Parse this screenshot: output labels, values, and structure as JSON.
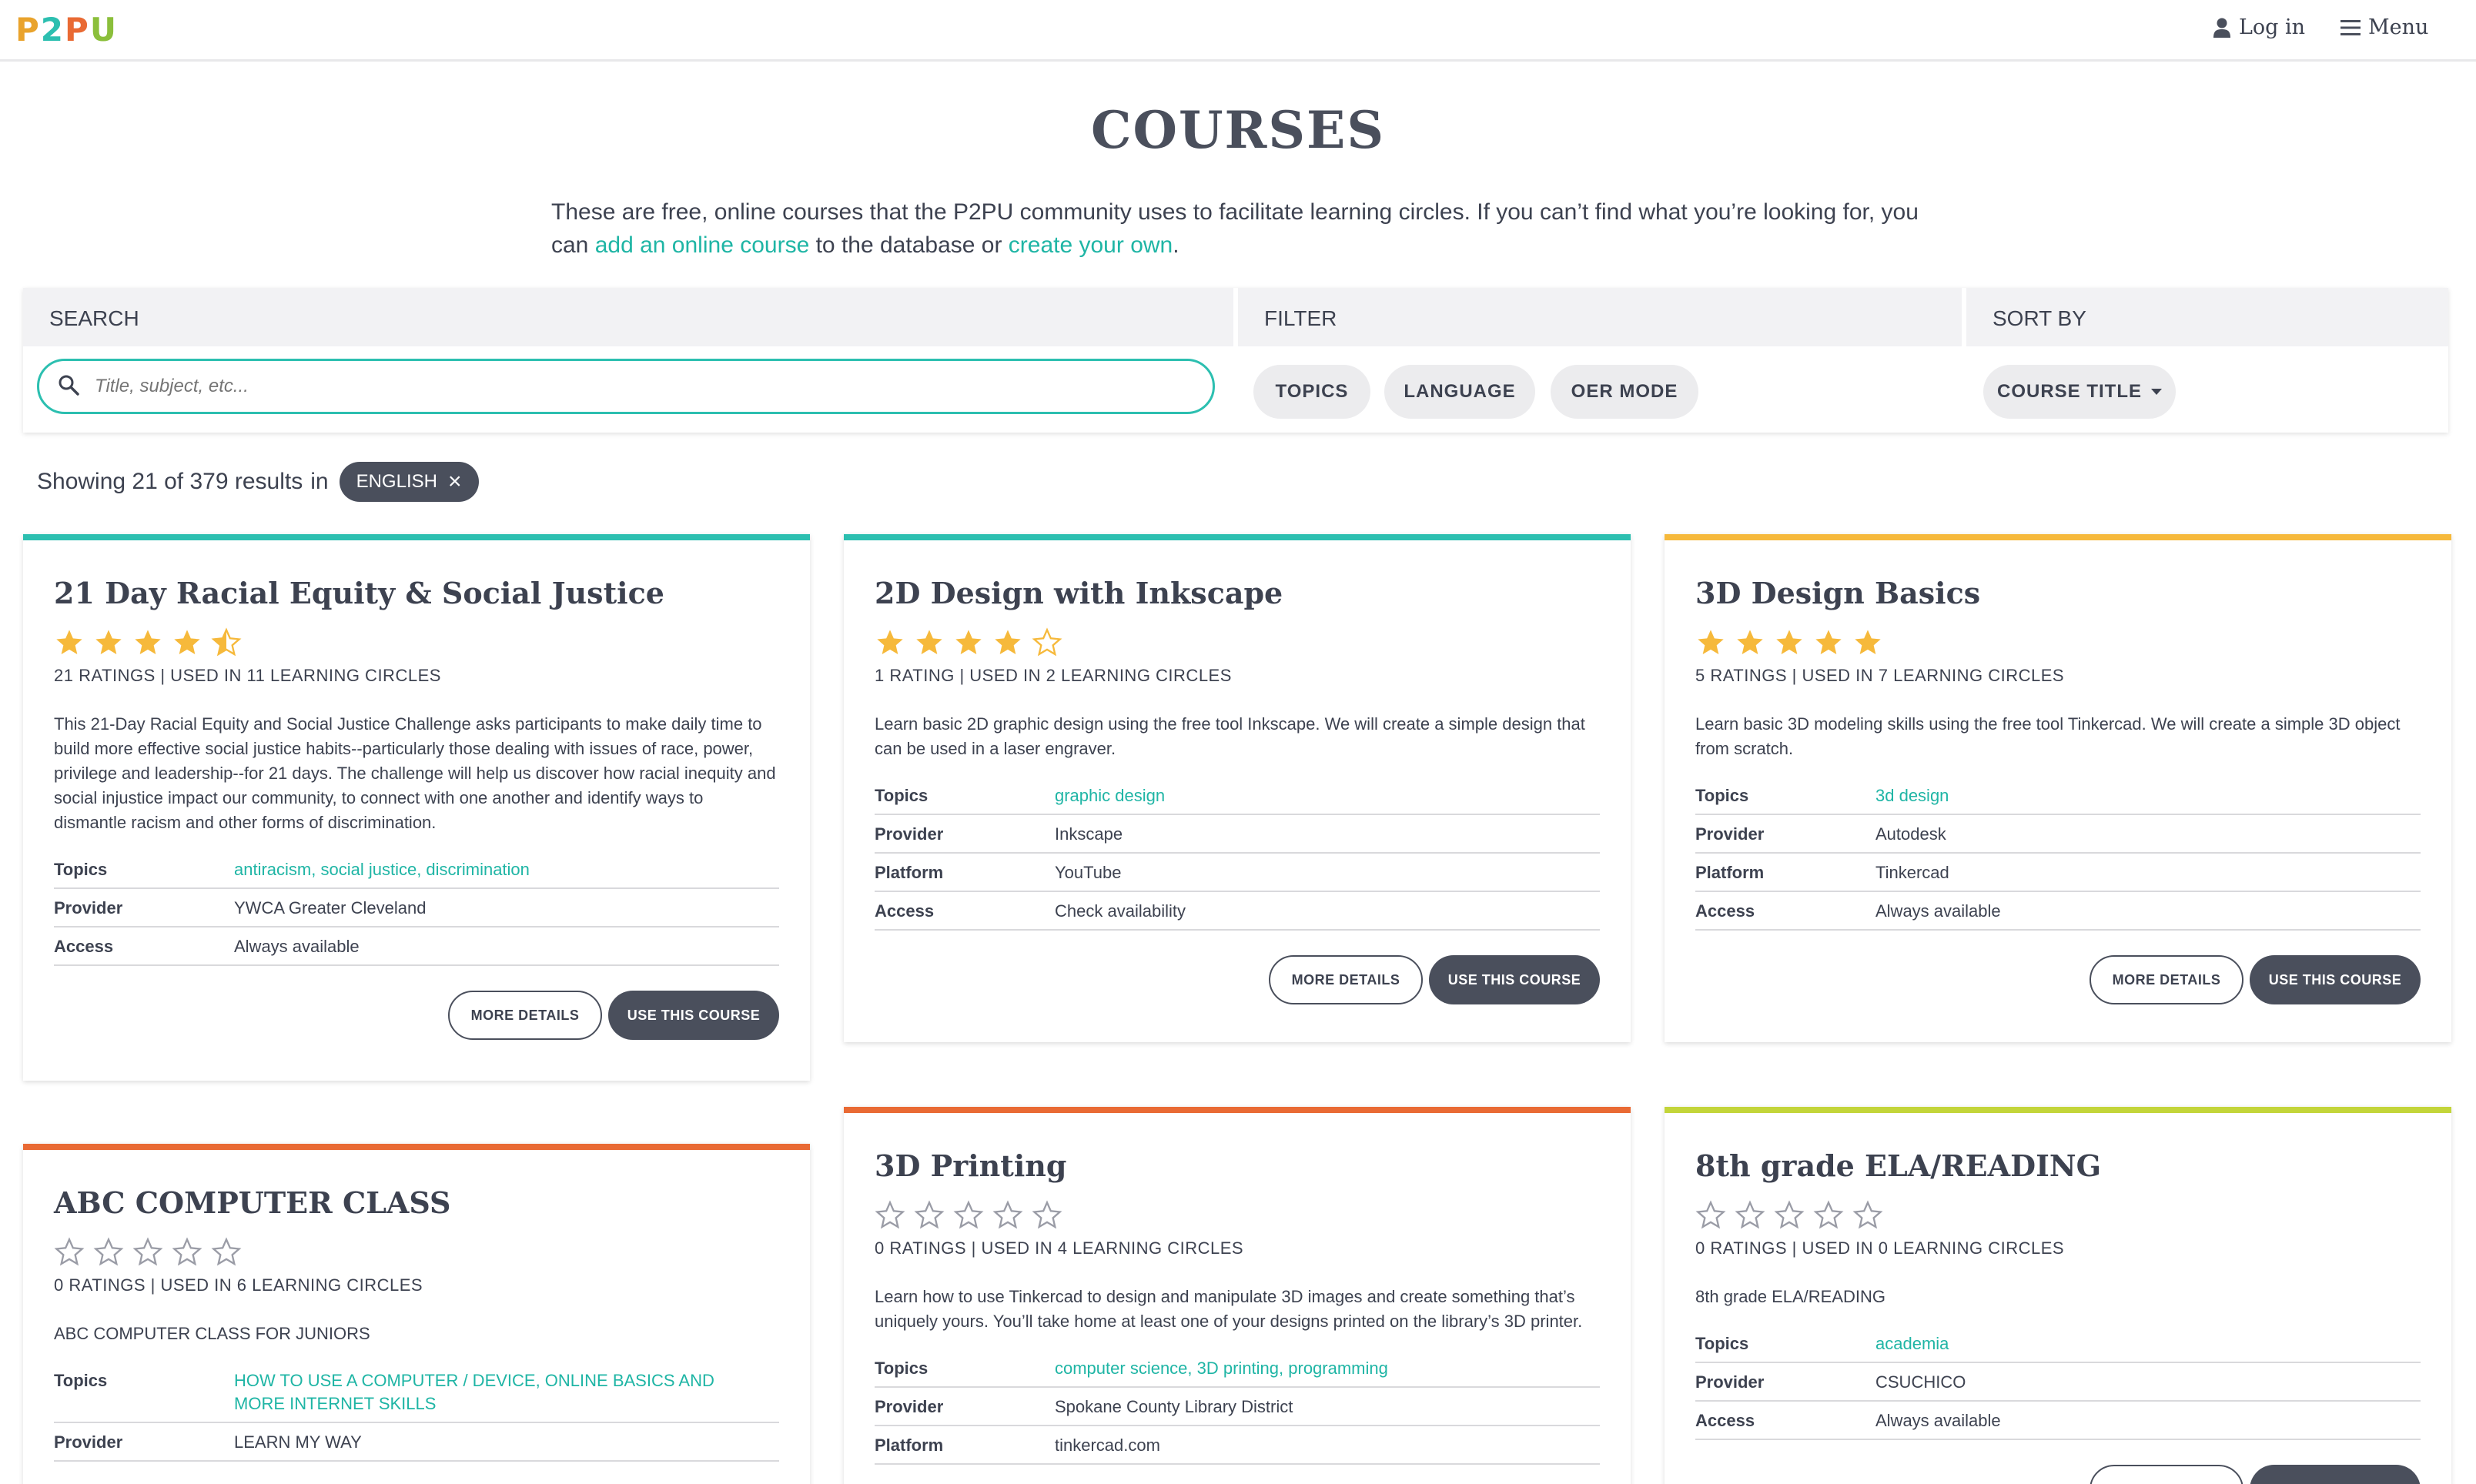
{
  "header": {
    "logo": [
      "P",
      "2",
      "P",
      "U"
    ],
    "login_label": "Log in",
    "menu_label": "Menu"
  },
  "page": {
    "title": "COURSES",
    "intro_before": "These are free, online courses that the P2PU community uses to facilitate learning circles. If you can’t find what you’re looking for, you can ",
    "intro_link1": "add an online course",
    "intro_middle": " to the database or ",
    "intro_link2": "create your own",
    "intro_after": "."
  },
  "controls": {
    "search_heading": "SEARCH",
    "filter_heading": "FILTER",
    "sort_heading": "SORT BY",
    "search_placeholder": "Title, subject, etc...",
    "filters": [
      "TOPICS",
      "LANGUAGE",
      "OER MODE"
    ],
    "sort_value": "COURSE TITLE"
  },
  "results": {
    "text": "Showing 21 of 379 results",
    "in_label": "in",
    "chip": "ENGLISH"
  },
  "labels": {
    "topics": "Topics",
    "provider": "Provider",
    "platform": "Platform",
    "access": "Access",
    "more_details": "MORE DETAILS",
    "use_course": "USE THIS COURSE"
  },
  "colors": {
    "teal": "#2cbfb0",
    "yellow": "#f6b93b",
    "orange": "#e96a34",
    "lime": "#c3d53a",
    "dark": "#4a4f5c"
  },
  "courses": [
    {
      "title": "21 Day Racial Equity & Social Justice",
      "rating": 4.5,
      "meta": "21 RATINGS | USED IN 11 LEARNING CIRCLES",
      "description": "This 21-Day Racial Equity and Social Justice Challenge asks participants to make daily time to build more effective social justice habits--particularly those dealing with issues of race, power, privilege and leadership--for 21 days. The challenge will help us discover how racial inequity and social injustice impact our community, to connect with one another and identify ways to dismantle racism and other forms of discrimination.",
      "topics": "antiracism, social justice, discrimination",
      "provider": "YWCA Greater Cleveland",
      "access": "Always available",
      "accent": "#2cbfb0"
    },
    {
      "title": "2D Design with Inkscape",
      "rating": 4,
      "meta": "1 RATING | USED IN 2 LEARNING CIRCLES",
      "description": "Learn basic 2D graphic design using the free tool Inkscape. We will create a simple design that can be used in a laser engraver.",
      "topics": "graphic design",
      "provider": "Inkscape",
      "platform": "YouTube",
      "access": "Check availability",
      "accent": "#2cbfb0"
    },
    {
      "title": "3D Design Basics",
      "rating": 5,
      "meta": "5 RATINGS | USED IN 7 LEARNING CIRCLES",
      "description": "Learn basic 3D modeling skills using the free tool Tinkercad. We will create a simple 3D object from scratch.",
      "topics": "3d design",
      "provider": "Autodesk",
      "platform": "Tinkercad",
      "access": "Always available",
      "accent": "#f6b93b"
    },
    {
      "title": "ABC COMPUTER CLASS",
      "rating": 0,
      "meta": "0 RATINGS | USED IN 6 LEARNING CIRCLES",
      "description": "ABC COMPUTER CLASS FOR JUNIORS",
      "topics": "HOW TO USE A COMPUTER / DEVICE, ONLINE BASICS AND MORE INTERNET SKILLS",
      "provider": "LEARN MY WAY",
      "accent": "#e96a34"
    },
    {
      "title": "3D Printing",
      "rating": 0,
      "meta": "0 RATINGS | USED IN 4 LEARNING CIRCLES",
      "description": "Learn how to use Tinkercad to design and manipulate 3D images and create something that’s uniquely yours. You’ll take home at least one of your designs printed on the library’s 3D printer.",
      "topics": "computer science, 3D printing, programming",
      "provider": "Spokane County Library District",
      "platform": "tinkercad.com",
      "accent": "#e96a34"
    },
    {
      "title": "8th grade ELA/READING",
      "rating": 0,
      "meta": "0 RATINGS | USED IN 0 LEARNING CIRCLES",
      "description": "8th grade ELA/READING",
      "topics": "academia",
      "provider": "CSUCHICO",
      "access": "Always available",
      "accent": "#c3d53a"
    }
  ]
}
